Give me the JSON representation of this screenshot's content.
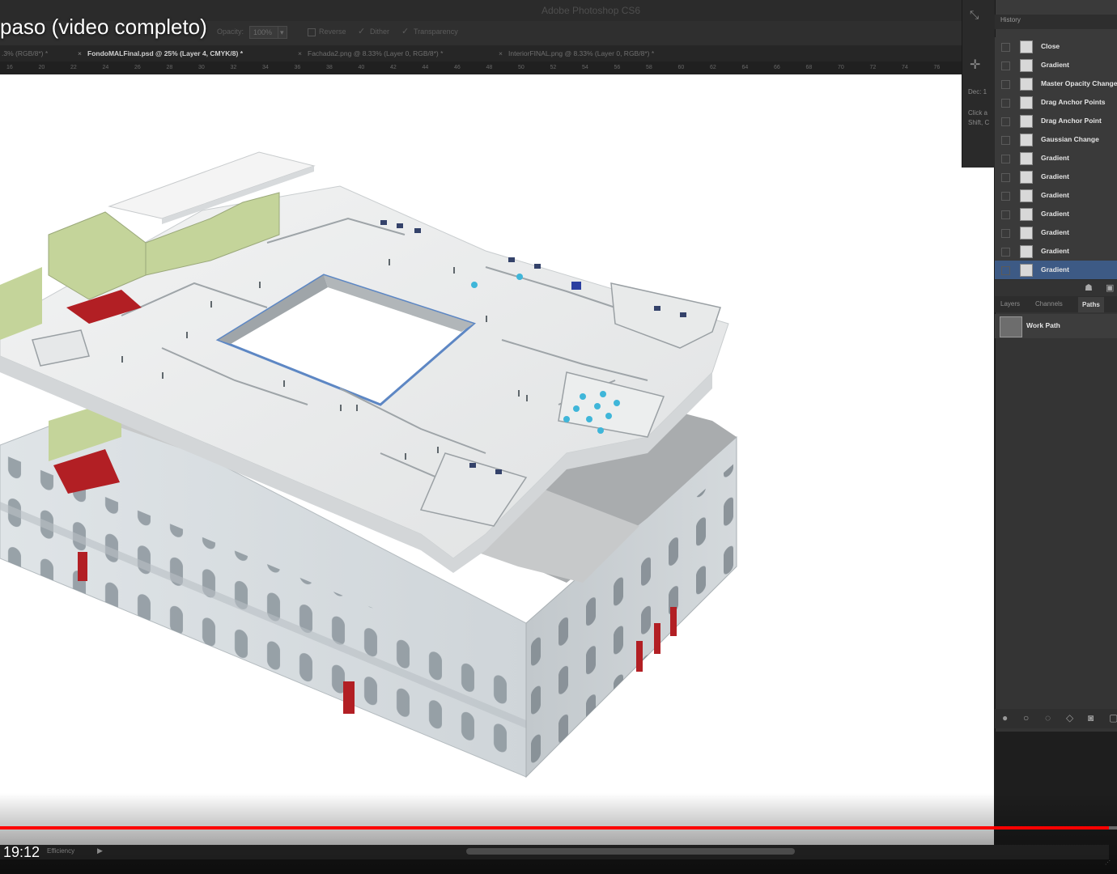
{
  "app": {
    "title": "Adobe Photoshop CS6"
  },
  "video": {
    "title": "paso (video completo)",
    "current_time": "19:12",
    "progress": 0.993
  },
  "options_bar": {
    "opacity_label": "Opacity:",
    "opacity_value": "100%",
    "reverse_label": "Reverse",
    "dither_label": "Dither",
    "transparency_label": "Transparency"
  },
  "doc_tabs": [
    {
      "label": ".3% (RGB/8*) *",
      "active": false
    },
    {
      "label": "FondoMALFinal.psd @ 25% (Layer 4, CMYK/8) *",
      "active": true
    },
    {
      "label": "Fachada2.png @ 8.33% (Layer 0, RGB/8*) *",
      "active": false
    },
    {
      "label": "InteriorFINAL.png @ 8.33% (Layer 0, RGB/8*) *",
      "active": false
    }
  ],
  "ruler_ticks": [
    "16",
    "20",
    "22",
    "24",
    "26",
    "28",
    "30",
    "32",
    "34",
    "36",
    "38",
    "40",
    "42",
    "44",
    "46",
    "48",
    "50",
    "52",
    "54",
    "56",
    "58",
    "60",
    "62",
    "64",
    "66",
    "68",
    "70",
    "72",
    "74",
    "76"
  ],
  "tool_dock": {
    "line1": "Dec: 1",
    "line2": "Click a",
    "line3": "Shift, C"
  },
  "history": {
    "tab": "History",
    "items": [
      {
        "label": "Close",
        "selected": false
      },
      {
        "label": "Gradient",
        "selected": false
      },
      {
        "label": "Master Opacity Change",
        "selected": false
      },
      {
        "label": "Drag Anchor Points",
        "selected": false
      },
      {
        "label": "Drag Anchor Point",
        "selected": false
      },
      {
        "label": "Gaussian Change",
        "selected": false
      },
      {
        "label": "Gradient",
        "selected": false
      },
      {
        "label": "Gradient",
        "selected": false
      },
      {
        "label": "Gradient",
        "selected": false
      },
      {
        "label": "Gradient",
        "selected": false
      },
      {
        "label": "Gradient",
        "selected": false
      },
      {
        "label": "Gradient",
        "selected": false
      },
      {
        "label": "Gradient",
        "selected": true
      }
    ]
  },
  "layers_panel": {
    "tabs": [
      {
        "label": "Layers",
        "active": false
      },
      {
        "label": "Channels",
        "active": false
      },
      {
        "label": "Paths",
        "active": true
      }
    ],
    "path_name": "Work Path"
  },
  "status": {
    "text": "Efficiency"
  },
  "colors": {
    "progress": "#ff0000",
    "selection": "#3d5a85",
    "accent_room": "#2e6fa8",
    "red_carpet": "#b21f24",
    "green_wall": "#c4d49a"
  }
}
